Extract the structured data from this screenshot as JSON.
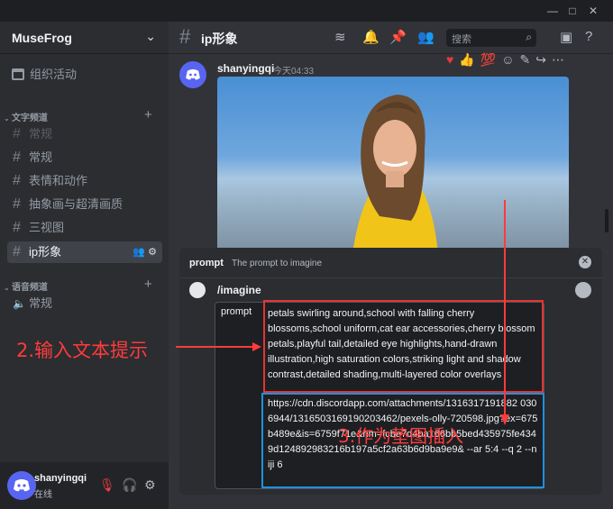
{
  "window": {
    "minimize": "—",
    "maximize": "□",
    "close": "✕"
  },
  "server": {
    "name": "MuseFrog"
  },
  "sidebar": {
    "event_label": "组织活动",
    "text_category": "文字频道",
    "voice_category": "语音频道",
    "channels": [
      {
        "label": "常规",
        "state": "muted"
      },
      {
        "label": "常规",
        "state": "normal"
      },
      {
        "label": "表情和动作",
        "state": "normal"
      },
      {
        "label": "抽象画与超清画质",
        "state": "normal"
      },
      {
        "label": "三视图",
        "state": "normal"
      },
      {
        "label": "ip形象",
        "state": "active"
      }
    ],
    "voice_channels": [
      {
        "label": "常规"
      }
    ]
  },
  "user": {
    "name": "shanyingqi",
    "status": "在线"
  },
  "header": {
    "channel": "ip形象",
    "search_placeholder": "搜索"
  },
  "message": {
    "author": "shanyingqi",
    "time": "今天04:33"
  },
  "command_popup": {
    "option_name": "prompt",
    "option_desc": "The prompt to imagine",
    "command": "/imagine",
    "field_label": "prompt",
    "prompt_text": "petals swirling around,school with falling cherry blossoms,school uniform,cat ear accessories,cherry blossom petals,playful tail,detailed eye highlights,hand-drawn illustration,high saturation colors,striking light and shadow contrast,detailed shading,multi-layered color overlays",
    "url_text": "https://cdn.discordapp.com/attachments/1316317191882 0306944/1316503169190203462/pexels-olly-720598.jpg?ex=675b489e&is=6759f71e&hm=fcbe7d4ba166bb5bed435975fe4349d124892983216b197a5cf2a63b6d9ba9e9& --ar 5:4 --q 2 --niji 6"
  },
  "annotations": {
    "step2": "2.输入文本提示",
    "step3": "3.作为垫图插入"
  },
  "colors": {
    "annotation_red": "#ff3b3b",
    "box_red": "#e53434",
    "box_blue": "#1f90e0",
    "blurple": "#5865f2"
  }
}
